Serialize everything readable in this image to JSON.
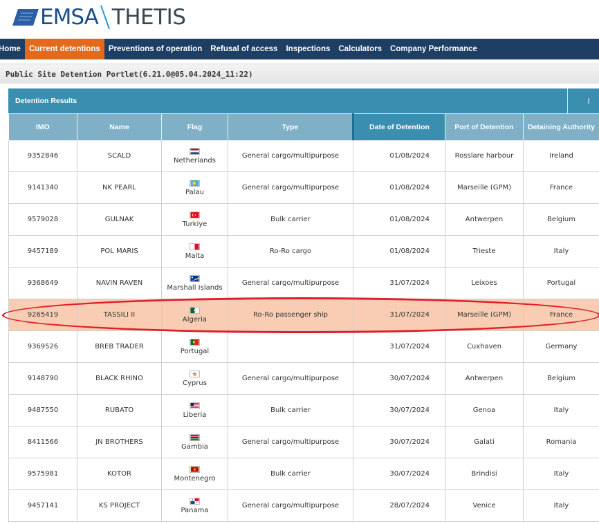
{
  "logo": {
    "left": "EMSA",
    "right": "THETIS"
  },
  "nav": [
    {
      "label": "Home",
      "active": false
    },
    {
      "label": "Current detentions",
      "active": true
    },
    {
      "label": "Preventions of operation",
      "active": false
    },
    {
      "label": "Refusal of access",
      "active": false
    },
    {
      "label": "Inspections",
      "active": false
    },
    {
      "label": "Calculators",
      "active": false
    },
    {
      "label": "Company Performance",
      "active": false
    }
  ],
  "portlet_title": "Public Site Detention Portlet(6.21.0@05.04.2024_11:22)",
  "results": {
    "title": "Detention Results",
    "columns": [
      "IMO",
      "Name",
      "Flag",
      "Type",
      "Date of Detention",
      "Port of Detention",
      "Detaining Authority"
    ],
    "rows": [
      {
        "imo": "9352846",
        "name": "SCALD",
        "flag": "Netherlands",
        "type": "General cargo/multipurpose",
        "date": "01/08/2024",
        "port": "Rosslare harbour",
        "authority": "Ireland"
      },
      {
        "imo": "9141340",
        "name": "NK PEARL",
        "flag": "Palau",
        "type": "General cargo/multipurpose",
        "date": "01/08/2024",
        "port": "Marseille (GPM)",
        "authority": "France"
      },
      {
        "imo": "9579028",
        "name": "GULNAK",
        "flag": "Turkiye",
        "type": "Bulk carrier",
        "date": "01/08/2024",
        "port": "Antwerpen",
        "authority": "Belgium"
      },
      {
        "imo": "9457189",
        "name": "POL MARIS",
        "flag": "Malta",
        "type": "Ro-Ro cargo",
        "date": "01/08/2024",
        "port": "Trieste",
        "authority": "Italy"
      },
      {
        "imo": "9368649",
        "name": "NAVIN RAVEN",
        "flag": "Marshall Islands",
        "type": "General cargo/multipurpose",
        "date": "31/07/2024",
        "port": "Leixoes",
        "authority": "Portugal"
      },
      {
        "imo": "9265419",
        "name": "TASSILI II",
        "flag": "Algeria",
        "type": "Ro-Ro passenger ship",
        "date": "31/07/2024",
        "port": "Marseille (GPM)",
        "authority": "France",
        "highlighted": true
      },
      {
        "imo": "9369526",
        "name": "BREB TRADER",
        "flag": "Portugal",
        "type": "",
        "date": "31/07/2024",
        "port": "Cuxhaven",
        "authority": "Germany"
      },
      {
        "imo": "9148790",
        "name": "BLACK RHINO",
        "flag": "Cyprus",
        "type": "General cargo/multipurpose",
        "date": "30/07/2024",
        "port": "Antwerpen",
        "authority": "Belgium"
      },
      {
        "imo": "9487550",
        "name": "RUBATO",
        "flag": "Liberia",
        "type": "Bulk carrier",
        "date": "30/07/2024",
        "port": "Genoa",
        "authority": "Italy"
      },
      {
        "imo": "8411566",
        "name": "JN BROTHERS",
        "flag": "Gambia",
        "type": "General cargo/multipurpose",
        "date": "30/07/2024",
        "port": "Galati",
        "authority": "Romania"
      },
      {
        "imo": "9575981",
        "name": "KOTOR",
        "flag": "Montenegro",
        "type": "Bulk carrier",
        "date": "30/07/2024",
        "port": "Brindisi",
        "authority": "Italy"
      },
      {
        "imo": "9457141",
        "name": "KS PROJECT",
        "flag": "Panama",
        "type": "General cargo/multipurpose",
        "date": "28/07/2024",
        "port": "Venice",
        "authority": "Italy"
      }
    ]
  },
  "colors": {
    "nav_bg": "#1e3f63",
    "nav_active": "#e36a1b",
    "header_blue": "#3a8fb0",
    "col_header": "#7fb0c7",
    "highlight_row": "#f8cdb3",
    "annotation": "#e01f2a"
  }
}
